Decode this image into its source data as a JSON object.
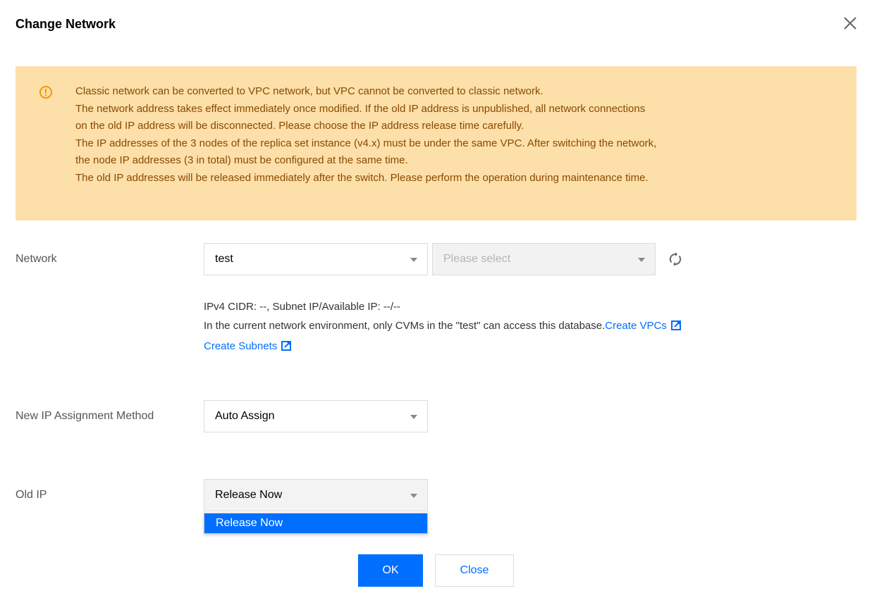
{
  "dialog": {
    "title": "Change Network",
    "close_icon": "close-icon"
  },
  "alert": {
    "icon": "warning-circle-icon",
    "lines": [
      "Classic network can be converted to VPC network, but VPC cannot be converted to classic network.",
      "The network address takes effect immediately once modified. If the old IP address is unpublished, all network connections",
      "on the old IP address will be disconnected. Please choose the IP address release time carefully.",
      "The IP addresses of the 3 nodes of the replica set instance (v4.x) must be under the same VPC. After switching the network,",
      "the node IP addresses (3 in total) must be configured at the same time.",
      "The old IP addresses will be released immediately after the switch. Please perform the operation during maintenance time."
    ],
    "colors": {
      "background": "#fcdfa9",
      "text": "#8a4a00",
      "icon": "#f29900"
    }
  },
  "form": {
    "network": {
      "label": "Network",
      "vpc_value": "test",
      "subnet_placeholder": "Please select",
      "refresh_icon": "refresh-icon",
      "info_line": "IPv4 CIDR: --, Subnet IP/Available IP: --/--",
      "access_note": "In the current network environment, only CVMs in the \"test\" can access this database.",
      "create_vpcs_link": "Create VPCs",
      "create_subnets_link": "Create Subnets",
      "external_link_icon": "external-link-icon"
    },
    "ip_assignment": {
      "label": "New IP Assignment Method",
      "value": "Auto Assign"
    },
    "old_ip": {
      "label": "Old IP",
      "value": "Release Now",
      "options": [
        "Release Now"
      ]
    }
  },
  "footer": {
    "ok_label": "OK",
    "close_label": "Close"
  },
  "colors": {
    "accent": "#006eff"
  }
}
